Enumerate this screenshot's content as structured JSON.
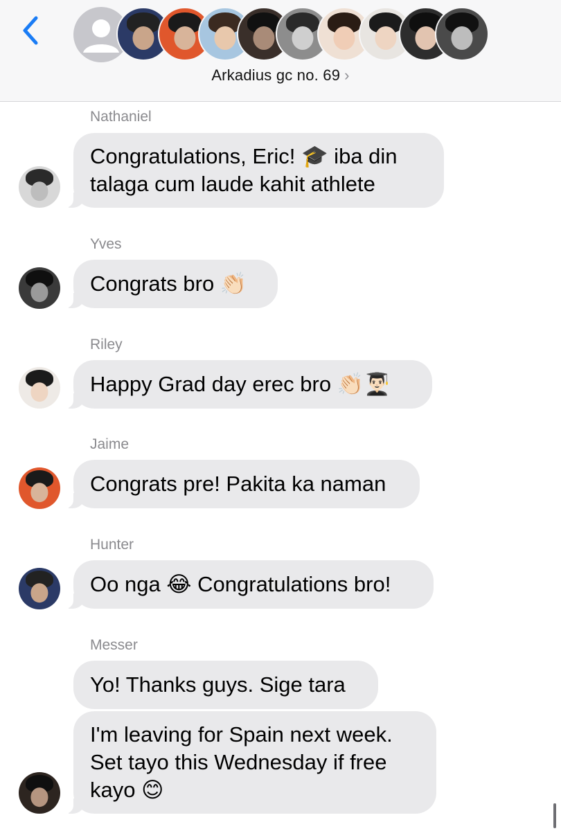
{
  "header": {
    "back_icon": "chevron-left-icon",
    "group_name": "Arkadius gc no. 69",
    "chevron": "›",
    "accent": "#1a7cf5"
  },
  "messages": [
    {
      "sender": "Nathaniel",
      "lines": "Congratulations, Eric! 🎓 iba din\ntalaga cum laude kahit athlete"
    },
    {
      "sender": "Yves",
      "lines": "Congrats bro 👏🏻"
    },
    {
      "sender": "Riley",
      "lines": "Happy Grad day erec bro 👏🏻👨🏻‍🎓"
    },
    {
      "sender": "Jaime",
      "lines": "Congrats pre! Pakita ka naman"
    },
    {
      "sender": "Hunter",
      "lines": "Oo nga 😂 Congratulations bro!"
    },
    {
      "sender": "Messer",
      "lines": "Yo! Thanks guys. Sige tara"
    },
    {
      "sender": "",
      "lines": "I'm leaving for Spain next week.\nSet tayo this Wednesday if free\nkayo 😊"
    }
  ],
  "colors": {
    "bubble": "#e9e9eb",
    "sender_name": "#8a8a8e",
    "header_bg": "#f7f7f8"
  }
}
